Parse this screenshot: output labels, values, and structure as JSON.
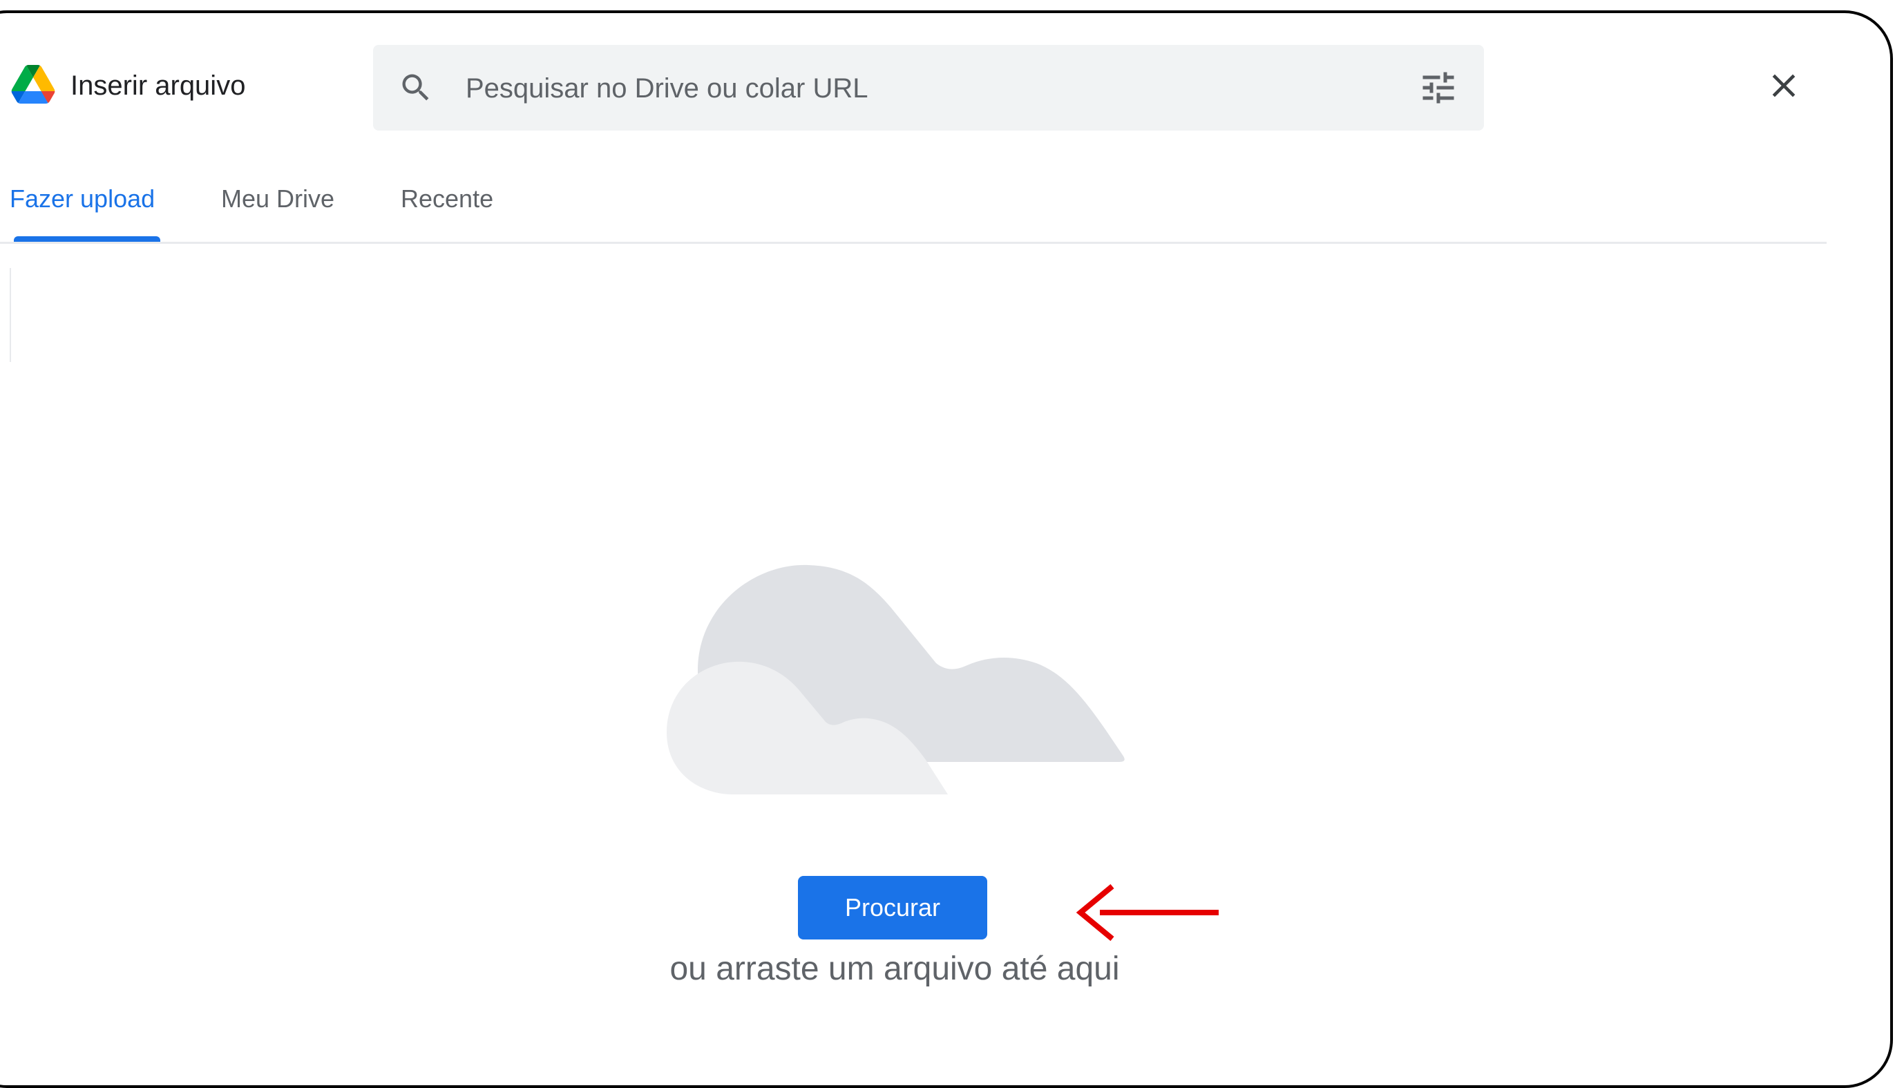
{
  "header": {
    "title": "Inserir arquivo",
    "logo_icon": "google-drive-logo",
    "search_placeholder": "Pesquisar no Drive ou colar URL",
    "search_icon": "search-icon",
    "filter_icon": "tune-icon",
    "close_icon": "close-icon"
  },
  "tabs": [
    {
      "label": "Fazer upload",
      "active": true
    },
    {
      "label": "Meu Drive",
      "active": false
    },
    {
      "label": "Recente",
      "active": false
    }
  ],
  "upload": {
    "illustration": "cloud-illustration",
    "browse_label": "Procurar",
    "drop_hint": "ou arraste um arquivo até aqui"
  },
  "annotation": {
    "arrow_icon": "red-arrow-left-icon",
    "color": "#e60000"
  },
  "colors": {
    "accent": "#1a73e8",
    "text": "#202124",
    "muted": "#5f6368",
    "search_bg": "#f1f3f4"
  }
}
